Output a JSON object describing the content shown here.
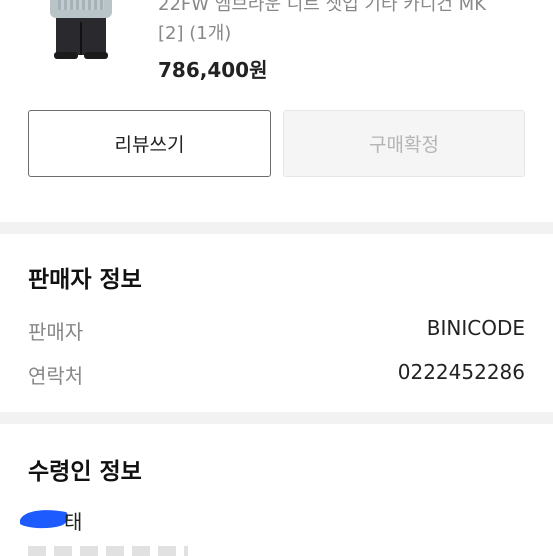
{
  "order_item": {
    "name": "22FW 엠브라운 니트 셋업 기타 카디건 MK",
    "option": "[2] (1개)",
    "price": "786,400원",
    "thumbnail_icon": "product-photo"
  },
  "actions": {
    "review_label": "리뷰쓰기",
    "confirm_label": "구매확정",
    "confirm_disabled": true
  },
  "seller_info": {
    "title": "판매자 정보",
    "rows": [
      {
        "label": "판매자",
        "value": "BINICODE"
      },
      {
        "label": "연락처",
        "value": "0222452286"
      }
    ]
  },
  "recipient_info": {
    "title": "수령인 정보",
    "name_visible": "태",
    "redaction_color": "#1e5bff"
  },
  "colors": {
    "section_gap": "#f2f2f2",
    "button_border": "#6d6d6d",
    "disabled_text": "#b5b5b5",
    "muted_text": "#888888"
  }
}
